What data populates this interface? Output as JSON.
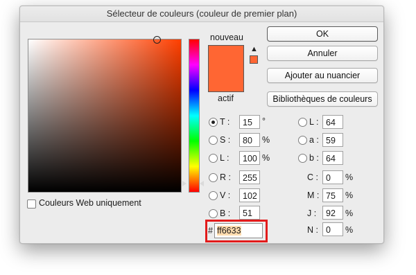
{
  "window": {
    "title": "Sélecteur de couleurs (couleur de premier plan)"
  },
  "preview": {
    "new_label": "nouveau",
    "current_label": "actif",
    "new_color": "#ff6633",
    "current_color": "#ff6633",
    "warning_icon": "gamut-warning-icon",
    "warning_symbol": "▲"
  },
  "buttons": {
    "ok": "OK",
    "cancel": "Annuler",
    "add_swatch": "Ajouter au nuancier",
    "libraries": "Bibliothèques de couleurs"
  },
  "web_only": {
    "label": "Couleurs Web uniquement",
    "checked": false
  },
  "hsb": [
    {
      "label": "T :",
      "value": "15",
      "unit": "°",
      "selected": true
    },
    {
      "label": "S :",
      "value": "80",
      "unit": "%",
      "selected": false
    },
    {
      "label": "L :",
      "value": "100",
      "unit": "%",
      "selected": false
    }
  ],
  "rgb": [
    {
      "label": "R :",
      "value": "255",
      "selected": false
    },
    {
      "label": "V :",
      "value": "102",
      "selected": false
    },
    {
      "label": "B :",
      "value": "51",
      "selected": false
    }
  ],
  "lab": [
    {
      "label": "L :",
      "value": "64",
      "selected": false
    },
    {
      "label": "a :",
      "value": "59",
      "selected": false
    },
    {
      "label": "b :",
      "value": "64",
      "selected": false
    }
  ],
  "cmyk": [
    {
      "label": "C :",
      "value": "0",
      "unit": "%"
    },
    {
      "label": "M :",
      "value": "75",
      "unit": "%"
    },
    {
      "label": "J :",
      "value": "92",
      "unit": "%"
    },
    {
      "label": "N :",
      "value": "0",
      "unit": "%"
    }
  ],
  "hex": {
    "prefix": "#",
    "value": "ff6633"
  },
  "colors": {
    "highlight": "#e21b1b",
    "selected_text_bg": "#ffdcae"
  }
}
